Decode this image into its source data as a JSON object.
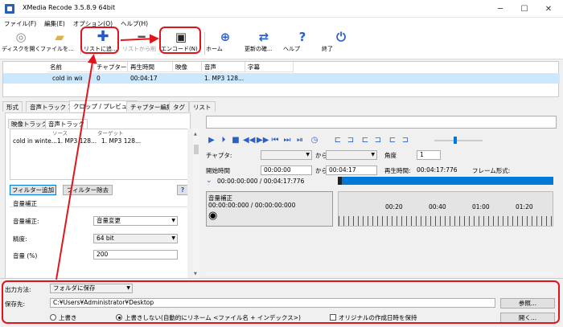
{
  "window": {
    "title": "XMedia Recode 3.5.8.9 64bit",
    "minimize": "─",
    "maximize": "☐",
    "close": "✕"
  },
  "menu": [
    "ファイル(F)",
    "編集(E)",
    "オプション(O)",
    "ヘルプ(H)"
  ],
  "toolbar": {
    "open_disc": "ディスクを開く",
    "open_file": "ファイルを...",
    "add_list": "リストに追...",
    "remove_list": "リストから削",
    "encode": "エンコード(N)",
    "home": "ホーム",
    "update": "更新の確...",
    "help": "ヘルプ",
    "exit": "終了"
  },
  "filelist": {
    "headers": [
      "名前",
      "チャプター",
      "再生時間",
      "映像",
      "音声",
      "字幕"
    ],
    "rows": [
      [
        "cold in winte",
        "0",
        "00:04:17",
        "",
        "1. MP3 128...",
        ""
      ]
    ]
  },
  "tabs": [
    "形式",
    "音声トラック 1",
    "クロップ / プレビュー",
    "チャプター編集",
    "タグ",
    "リスト"
  ],
  "left": {
    "subtabs": [
      "映像トラック",
      "音声トラック"
    ],
    "track_headers": [
      "ソース",
      "ターゲット"
    ],
    "track_row": [
      "cold in winte...",
      "1. MP3 128...",
      "1. MP3 128..."
    ],
    "add_filter": "フィルター追加",
    "remove_filter": "フィルター除去",
    "help_q": "?",
    "group_title": "音量補正",
    "vol_adjust_label": "音量補正:",
    "vol_adjust_value": "音量変更",
    "precision_label": "精度:",
    "precision_value": "64 bit",
    "volume_label": "音量 (%)",
    "volume_value": "200"
  },
  "right": {
    "chapter_label": "チャプタ:",
    "from_label": "から",
    "angle_label": "角度",
    "angle_value": "1",
    "start_label": "開始時間",
    "start_value": "00:00:00",
    "to_label": "から",
    "to_value": "00:04:17",
    "duration_label": "再生時間:",
    "duration_value": "00:04:17:776",
    "frame_label": "フレーム形式:",
    "timecode": "00:00:00:000 / 00:04:17:776",
    "clip_title": "音量補正",
    "clip_time": "00:00:00:000 / 00:00:00:000",
    "timeline_ticks": [
      "00:20",
      "00:40",
      "01:00",
      "01:20"
    ],
    "progress": 0.02
  },
  "bottom": {
    "output_method_label": "出力方法:",
    "output_method_value": "フォルダに保存",
    "save_to_label": "保存先:",
    "save_to_value": "C:¥Users¥Administrator¥Desktop",
    "browse": "参照...",
    "open": "開く...",
    "overwrite": "上書き",
    "no_overwrite": "上書きしない(自動的にリネーム <ファイル名 + インデックス>)",
    "keep_date": "オリジナルの作成日時を保持"
  },
  "colors": {
    "annotation": "#e0151b",
    "accent": "#0078d7",
    "toolbar_icon": "#2a5fc6",
    "selection": "#cce8ff"
  }
}
